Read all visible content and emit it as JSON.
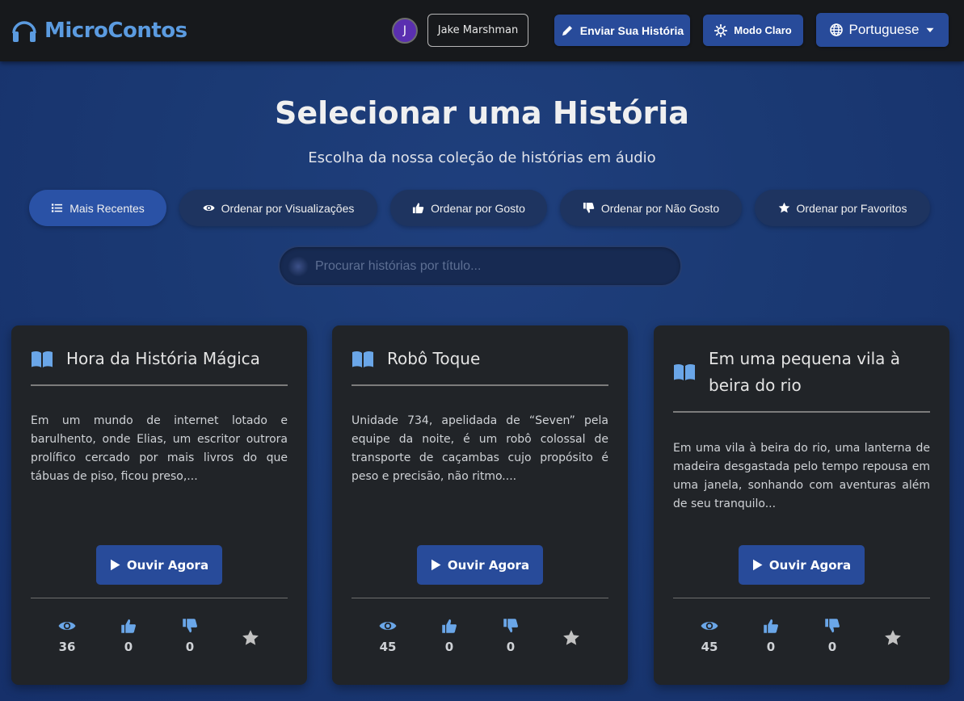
{
  "navbar": {
    "brand": "MicroContos",
    "avatar_initial": "J",
    "user_name": "Jake Marshman",
    "submit_label": "Enviar Sua História",
    "theme_label": "Modo Claro",
    "language_label": "Portuguese"
  },
  "header": {
    "title": "Selecionar uma História",
    "subtitle": "Escolha da nossa coleção de histórias em áudio"
  },
  "sort": {
    "recent": "Mais Recentes",
    "views": "Ordenar por Visualizações",
    "likes": "Ordenar por Gosto",
    "dislikes": "Ordenar por Não Gosto",
    "favorites": "Ordenar por Favoritos",
    "active": "recent"
  },
  "search": {
    "placeholder": "Procurar histórias por título..."
  },
  "stories": [
    {
      "title": "Hora da História Mágica",
      "excerpt": "Em um mundo de internet lotado e barulhento, onde Elias, um escritor outrora prolífico cercado por mais livros do que tábuas de piso, ficou preso,...",
      "listen_label": "Ouvir Agora",
      "views": "36",
      "likes": "0",
      "dislikes": "0"
    },
    {
      "title": "Robô Toque",
      "excerpt": "Unidade 734, apelidada de “Seven” pela equipe da noite, é um robô colossal de transporte de caçambas cujo propósito é peso e precisão, não ritmo....",
      "listen_label": "Ouvir Agora",
      "views": "45",
      "likes": "0",
      "dislikes": "0"
    },
    {
      "title": "Em uma pequena vila à beira do rio",
      "excerpt": "Em uma vila à beira do rio, uma lanterna de madeira desgastada pelo tempo repousa em uma janela, sonhando com aventuras além de seu tranquilo...",
      "listen_label": "Ouvir Agora",
      "views": "45",
      "likes": "0",
      "dislikes": "0"
    }
  ],
  "colors": {
    "brand": "#5b9be0",
    "navbar_bg": "#17191c",
    "page_bg": "#1b3a74",
    "button_blue": "#284b9a",
    "card_bg": "#212428",
    "icon_blue": "#6aa6e8",
    "star_gray": "#c2c2c2"
  },
  "icons": {
    "brand": "headphones-icon",
    "submit": "pencil-icon",
    "theme": "sun-icon",
    "language": "globe-icon",
    "language_caret": "caret-down-icon",
    "recent": "list-icon",
    "views": "eye-icon",
    "likes": "thumbs-up-icon",
    "dislikes": "thumbs-down-icon",
    "favorites": "star-icon",
    "story": "open-book-icon",
    "listen": "play-icon"
  }
}
